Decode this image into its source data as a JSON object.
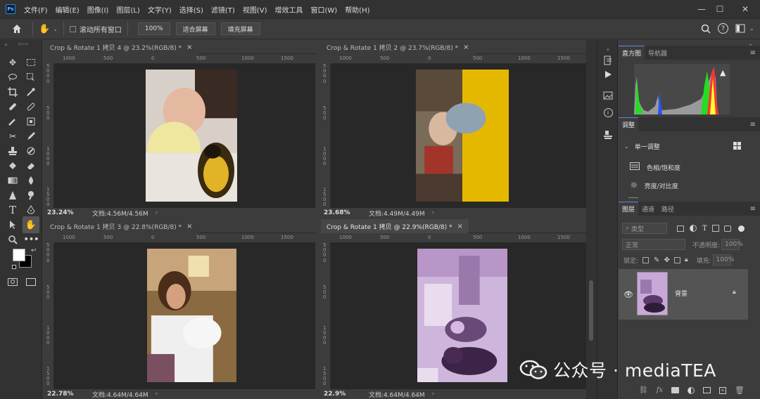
{
  "app": {
    "logo": "Ps"
  },
  "menu": [
    "文件(F)",
    "编辑(E)",
    "图像(I)",
    "图层(L)",
    "文字(Y)",
    "选择(S)",
    "滤镜(T)",
    "视图(V)",
    "增效工具",
    "窗口(W)",
    "帮助(H)"
  ],
  "window_controls": {
    "minimize": "—",
    "maximize": "☐",
    "close": "✕"
  },
  "options": {
    "scroll_all": "滚动所有窗口",
    "zoom": "100%",
    "fit_screen": "适合屏幕",
    "fill_screen": "填充屏幕"
  },
  "docs": [
    {
      "tab": "Crop & Rotate 1 拷贝 4 @ 23.2%(RGB/8) *",
      "zoom": "23.24%",
      "doc": "文档:4.56M/4.56M",
      "hticks": [
        "1000",
        "500",
        "0",
        "500",
        "1000",
        "1500"
      ],
      "vticks": [
        "5 0 0",
        "0",
        "5 0 0",
        "1 0 0 0",
        "1 5 0 0"
      ]
    },
    {
      "tab": "Crop & Rotate 1 拷贝 2 @ 23.7%(RGB/8) *",
      "zoom": "23.68%",
      "doc": "文档:4.49M/4.49M",
      "hticks": [
        "1000",
        "500",
        "0",
        "500",
        "1000",
        "1500"
      ],
      "vticks": [
        "5 0 0",
        "0",
        "5 0 0",
        "1 0 0 0",
        "1 5 0 0"
      ]
    },
    {
      "tab": "Crop & Rotate 1 拷贝 3 @ 22.8%(RGB/8) *",
      "zoom": "22.78%",
      "doc": "文档:4.64M/4.64M",
      "hticks": [
        "1000",
        "500",
        "0",
        "500",
        "1000",
        "1500"
      ],
      "vticks": [
        "5 0 0",
        "0",
        "5 0 0",
        "1 0 0 0",
        "1 5 0 0"
      ]
    },
    {
      "tab": "Crop & Rotate 1 拷贝 @ 22.9%(RGB/8) *",
      "zoom": "22.9%",
      "doc": "文档:4.64M/4.64M",
      "hticks": [
        "1000",
        "500",
        "0",
        "500",
        "1000",
        "1500"
      ],
      "vticks": [
        "5 0 0",
        "0",
        "5 0 0",
        "1 0 0 0",
        "1 5 0 0"
      ]
    }
  ],
  "panels": {
    "histogram_tab": "直方图",
    "navigator_tab": "导航器",
    "adjust_tab": "调整",
    "single_adjust": "单一调整",
    "hue_sat": "色相/饱和度",
    "bright_contrast": "亮度/对比度",
    "layers_tab": "图层",
    "channels_tab": "通道",
    "paths_tab": "路径",
    "filter_kind": "类型",
    "blend_mode": "正常",
    "opacity_label": "不透明度:",
    "opacity_value": "100%",
    "lock_label": "锁定:",
    "fill_label": "填充:",
    "fill_value": "100%",
    "layer_name": "背景"
  },
  "watermark": "公众号 · mediaTEA",
  "colors": {
    "accent": "#5a8ad6",
    "chrome_dark": "#323232",
    "chrome": "#3c3c3c",
    "canvas": "#282828"
  }
}
